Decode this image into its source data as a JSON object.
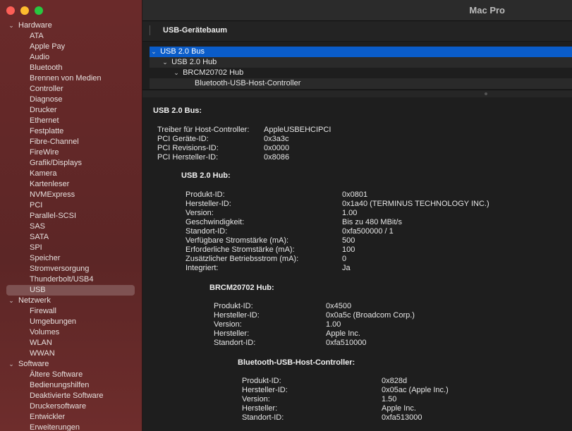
{
  "window": {
    "title": "Mac Pro"
  },
  "sidebar": {
    "categories": [
      {
        "label": "Hardware",
        "items": [
          "ATA",
          "Apple Pay",
          "Audio",
          "Bluetooth",
          "Brennen von Medien",
          "Controller",
          "Diagnose",
          "Drucker",
          "Ethernet",
          "Festplatte",
          "Fibre-Channel",
          "FireWire",
          "Grafik/Displays",
          "Kamera",
          "Kartenleser",
          "NVMExpress",
          "PCI",
          "Parallel-SCSI",
          "SAS",
          "SATA",
          "SPI",
          "Speicher",
          "Stromversorgung",
          "Thunderbolt/USB4",
          "USB"
        ]
      },
      {
        "label": "Netzwerk",
        "items": [
          "Firewall",
          "Umgebungen",
          "Volumes",
          "WLAN",
          "WWAN"
        ]
      },
      {
        "label": "Software",
        "items": [
          "Ältere Software",
          "Bedienungshilfen",
          "Deaktivierte Software",
          "Druckersoftware",
          "Entwickler",
          "Erweiterungen"
        ]
      }
    ],
    "selected": "USB"
  },
  "header": {
    "section_title": "USB-Gerätebaum"
  },
  "device_tree": [
    {
      "label": "USB 2.0 Bus",
      "expanded": true
    },
    {
      "label": "USB 2.0 Hub",
      "expanded": true
    },
    {
      "label": "BRCM20702 Hub",
      "expanded": true
    },
    {
      "label": "Bluetooth-USB-Host-Controller"
    }
  ],
  "details": {
    "bus": {
      "title": "USB 2.0 Bus:",
      "rows": [
        {
          "k": "Treiber für Host-Controller:",
          "v": "AppleUSBEHCIPCI"
        },
        {
          "k": "PCI Geräte-ID:",
          "v": "0x3a3c"
        },
        {
          "k": "PCI Revisions-ID:",
          "v": "0x0000"
        },
        {
          "k": "PCI Hersteller-ID:",
          "v": "0x8086"
        }
      ]
    },
    "hub": {
      "title": "USB 2.0 Hub:",
      "rows": [
        {
          "k": "Produkt-ID:",
          "v": "0x0801"
        },
        {
          "k": "Hersteller-ID:",
          "v": "0x1a40  (TERMINUS TECHNOLOGY INC.)"
        },
        {
          "k": "Version:",
          "v": "1.00"
        },
        {
          "k": "Geschwindigkeit:",
          "v": "Bis zu 480 MBit/s"
        },
        {
          "k": "Standort-ID:",
          "v": "0xfa500000 / 1"
        },
        {
          "k": "Verfügbare Stromstärke (mA):",
          "v": "500"
        },
        {
          "k": "Erforderliche Stromstärke (mA):",
          "v": "100"
        },
        {
          "k": "Zusätzlicher Betriebsstrom (mA):",
          "v": "0"
        },
        {
          "k": "Integriert:",
          "v": "Ja"
        }
      ]
    },
    "brcm": {
      "title": "BRCM20702 Hub:",
      "rows": [
        {
          "k": "Produkt-ID:",
          "v": "0x4500"
        },
        {
          "k": "Hersteller-ID:",
          "v": "0x0a5c  (Broadcom Corp.)"
        },
        {
          "k": "Version:",
          "v": "1.00"
        },
        {
          "k": "Hersteller:",
          "v": "Apple Inc."
        },
        {
          "k": "Standort-ID:",
          "v": "0xfa510000"
        }
      ]
    },
    "bt": {
      "title": "Bluetooth-USB-Host-Controller:",
      "rows": [
        {
          "k": "Produkt-ID:",
          "v": "0x828d"
        },
        {
          "k": "Hersteller-ID:",
          "v": "0x05ac (Apple Inc.)"
        },
        {
          "k": "Version:",
          "v": "1.50"
        },
        {
          "k": "Hersteller:",
          "v": "Apple Inc."
        },
        {
          "k": "Standort-ID:",
          "v": "0xfa513000"
        }
      ]
    }
  }
}
